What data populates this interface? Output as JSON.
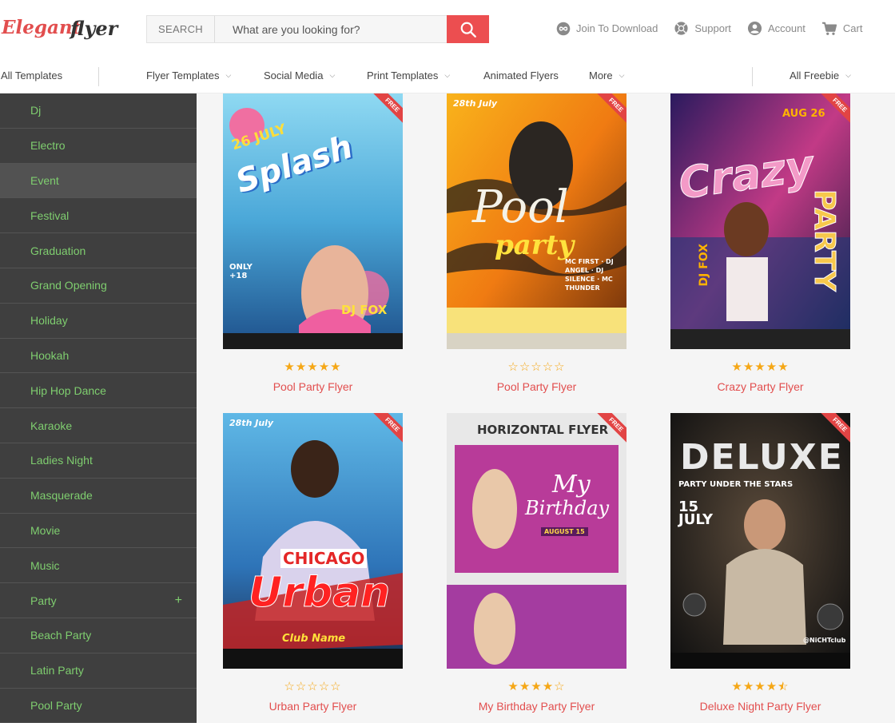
{
  "brand": {
    "logo_text_1": "Elegant",
    "logo_text_2": "flyer",
    "accent": "#ec4e50",
    "link_color": "#7fce6f"
  },
  "search": {
    "label": "SEARCH",
    "placeholder": "What are you looking for?"
  },
  "header_links": [
    {
      "label": "Join To Download",
      "icon": "infinity-icon"
    },
    {
      "label": "Support",
      "icon": "lifebuoy-icon"
    },
    {
      "label": "Account",
      "icon": "user-icon"
    },
    {
      "label": "Cart",
      "icon": "cart-icon"
    }
  ],
  "nav": {
    "all_templates": "All Templates",
    "flyer_templates": "Flyer Templates",
    "social_media": "Social Media",
    "print_templates": "Print Templates",
    "animated_flyers": "Animated Flyers",
    "more": "More",
    "all_freebie": "All Freebie"
  },
  "sidebar": {
    "items": [
      {
        "label": "Dj"
      },
      {
        "label": "Electro"
      },
      {
        "label": "Event"
      },
      {
        "label": "Festival"
      },
      {
        "label": "Graduation"
      },
      {
        "label": "Grand Opening"
      },
      {
        "label": "Holiday"
      },
      {
        "label": "Hookah"
      },
      {
        "label": "Hip Hop Dance"
      },
      {
        "label": "Karaoke"
      },
      {
        "label": "Ladies Night"
      },
      {
        "label": "Masquerade"
      },
      {
        "label": "Movie"
      },
      {
        "label": "Music"
      },
      {
        "label": "Party",
        "expand": "+"
      },
      {
        "label": "Beach Party"
      },
      {
        "label": "Latin Party"
      },
      {
        "label": "Pool Party"
      }
    ]
  },
  "cards": [
    {
      "title": "Pool Party Flyer",
      "rating": 5,
      "badge": "FREE",
      "poster": {
        "line1": "26 JULY",
        "line2": "Splash",
        "line3": "DJ FOX",
        "line4": "ONLY +18"
      }
    },
    {
      "title": "Pool Party Flyer",
      "rating": 0,
      "badge": "FREE",
      "poster": {
        "line1": "28th July",
        "line2": "Pool",
        "line3": "party",
        "line4": "MC FIRST · DJ ANGEL · DJ SILENCE · MC THUNDER"
      }
    },
    {
      "title": "Crazy Party Flyer",
      "rating": 5,
      "badge": "FREE",
      "poster": {
        "line1": "AUG 26",
        "line2": "Crazy",
        "line3": "PARTY",
        "line4": "DJ FOX"
      }
    },
    {
      "title": "Urban Party Flyer",
      "rating": 0,
      "badge": "FREE",
      "poster": {
        "line1": "28th July",
        "line2": "CHICAGO",
        "line3": "Urban",
        "line4": "Club Name"
      }
    },
    {
      "title": "My Birthday Party Flyer",
      "rating": 4,
      "badge": "FREE",
      "poster": {
        "line1": "HORIZONTAL FLYER",
        "line2": "My",
        "line3": "Birthday",
        "line4": "AUGUST 15"
      }
    },
    {
      "title": "Deluxe Night Party Flyer",
      "rating": 4.5,
      "badge": "FREE",
      "poster": {
        "line1": "DELUXE",
        "line2": "PARTY UNDER THE STARS",
        "line3": "15 JULY",
        "line4": "@NiCHTclub"
      }
    }
  ]
}
